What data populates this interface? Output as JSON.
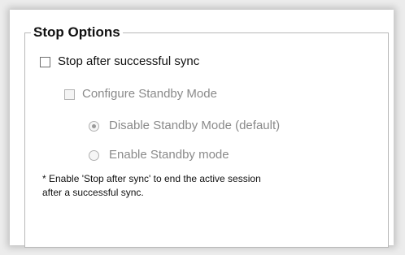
{
  "group": {
    "title": "Stop Options"
  },
  "options": {
    "stop_after_sync": {
      "label": "Stop after successful sync",
      "checked": false,
      "enabled": true
    },
    "configure_standby": {
      "label": "Configure Standby Mode",
      "checked": false,
      "enabled": false
    },
    "disable_standby": {
      "label": "Disable Standby Mode (default)",
      "selected": true,
      "enabled": false
    },
    "enable_standby": {
      "label": "Enable Standby mode",
      "selected": false,
      "enabled": false
    }
  },
  "note": {
    "line1": "* Enable 'Stop after sync' to end the active session",
    "line2": "after a successful sync."
  }
}
